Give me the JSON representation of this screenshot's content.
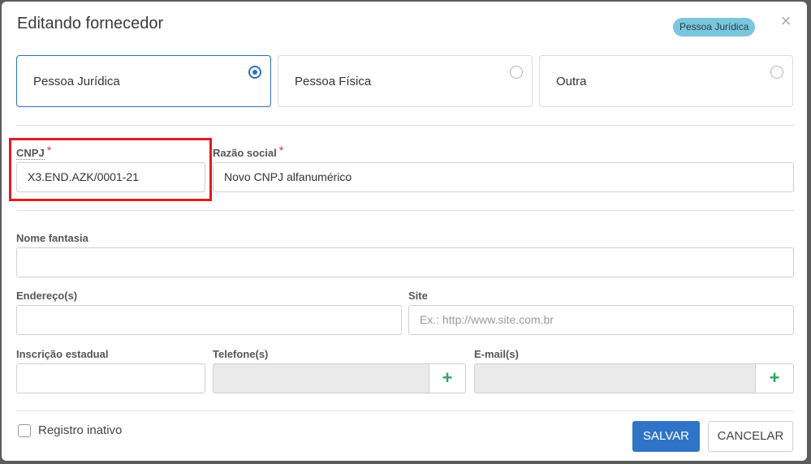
{
  "dialog": {
    "title": "Editando fornecedor",
    "badge": "Pessoa Jurídica",
    "close_symbol": "×"
  },
  "person_types": [
    {
      "label": "Pessoa Jurídica",
      "selected": true
    },
    {
      "label": "Pessoa Física",
      "selected": false
    },
    {
      "label": "Outra",
      "selected": false
    }
  ],
  "fields": {
    "cnpj": {
      "label": "CNPJ",
      "required_mark": "*",
      "value": "X3.END.AZK/0001-21"
    },
    "razao_social": {
      "label": "Razão social",
      "required_mark": "*",
      "value": "Novo CNPJ alfanumérico"
    },
    "nome_fantasia": {
      "label": "Nome fantasia",
      "value": ""
    },
    "enderecos": {
      "label": "Endereço(s)",
      "value": ""
    },
    "site": {
      "label": "Site",
      "value": "",
      "placeholder": "Ex.: http://www.site.com.br"
    },
    "inscricao_estadual": {
      "label": "Inscrição estadual",
      "value": ""
    },
    "telefones": {
      "label": "Telefone(s)",
      "value": "",
      "add_symbol": "+"
    },
    "emails": {
      "label": "E-mail(s)",
      "value": "",
      "add_symbol": "+"
    }
  },
  "footer": {
    "inactive_label": "Registro inativo",
    "inactive_checked": false,
    "save_label": "SALVAR",
    "cancel_label": "CANCELAR"
  },
  "colors": {
    "primary": "#2f74c7",
    "selected_border": "#2f6fb7",
    "badge_bg": "#7cc6dd",
    "highlight": "#e01b23",
    "add_icon": "#2ea464",
    "required": "#d9302c"
  }
}
